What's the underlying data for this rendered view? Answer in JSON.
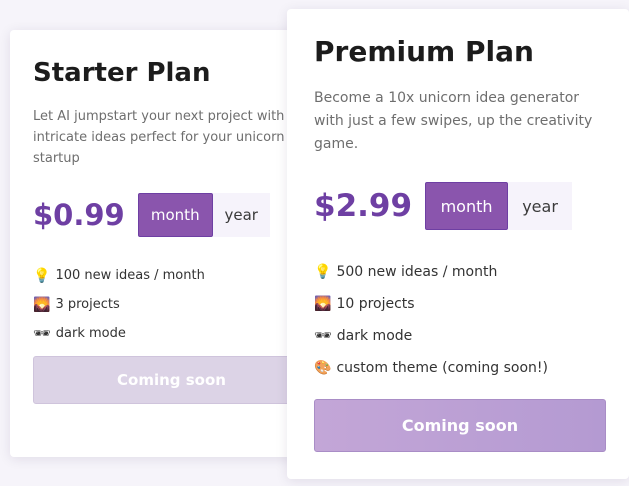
{
  "starter": {
    "title": "Starter Plan",
    "description": "Let AI jumpstart your next project with intricate ideas perfect for your unicorn startup",
    "price": "$0.99",
    "period_options": [
      "month",
      "year"
    ],
    "selected_period": "month",
    "features": [
      {
        "icon": "lightbulb-icon",
        "emoji": "💡",
        "text": "100 new ideas / month"
      },
      {
        "icon": "sunrise-photo-icon",
        "emoji": "🌄",
        "text": "3 projects"
      },
      {
        "icon": "sunglasses-icon",
        "emoji": "🕶",
        "text": "dark mode"
      }
    ],
    "cta_label": "Coming soon"
  },
  "premium": {
    "title": "Premium Plan",
    "description": "Become a 10x unicorn idea generator with just a few swipes, up the creativity game.",
    "price": "$2.99",
    "period_options": [
      "month",
      "year"
    ],
    "selected_period": "month",
    "features": [
      {
        "icon": "lightbulb-icon",
        "emoji": "💡",
        "text": "500 new ideas / month"
      },
      {
        "icon": "sunrise-photo-icon",
        "emoji": "🌄",
        "text": "10 projects"
      },
      {
        "icon": "sunglasses-icon",
        "emoji": "🕶",
        "text": "dark mode"
      },
      {
        "icon": "palette-icon",
        "emoji": "🎨",
        "text": "custom theme (coming soon!)"
      }
    ],
    "cta_label": "Coming soon"
  },
  "colors": {
    "accent": "#8a55ad",
    "price": "#6e3fa3",
    "toggle_inactive_bg": "#f6f3fb",
    "starter_cta_bg": "#dcd3e6",
    "premium_cta_bg": "#bca0d5"
  }
}
